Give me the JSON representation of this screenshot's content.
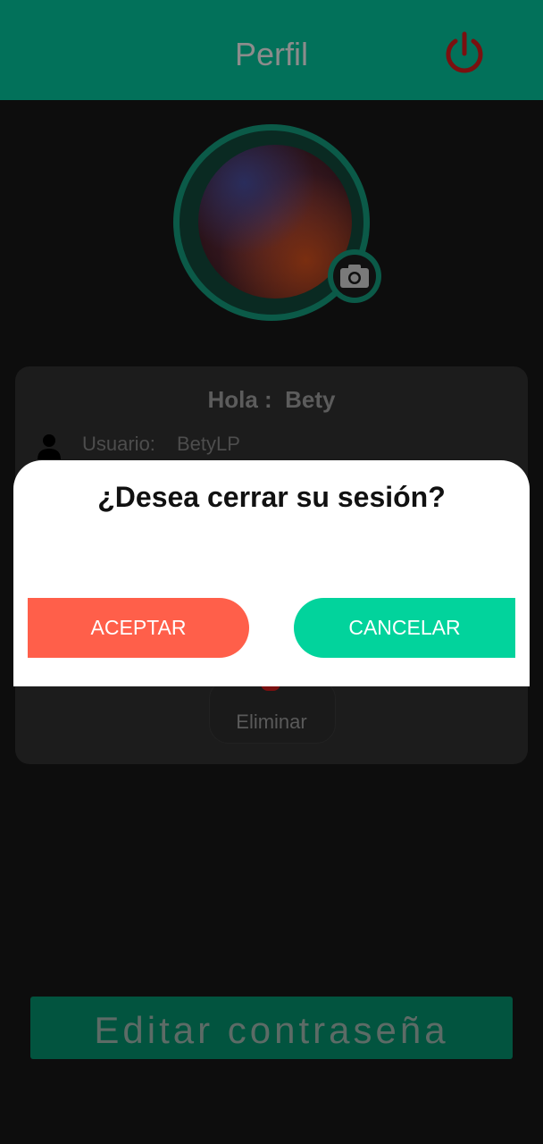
{
  "header": {
    "title": "Perfil",
    "logout_icon": "power-icon",
    "accent": "#02715a",
    "icon_color": "#7a1010"
  },
  "profile": {
    "avatar_icon": "camera-icon",
    "greeting_prefix": "Hola :",
    "greeting_name": "Bety",
    "user_label": "Usuario:",
    "user_value": "BetyLP",
    "delete_label": "Eliminar"
  },
  "footer": {
    "edit_password_label": "Editar contraseña"
  },
  "dialog": {
    "title": "¿Desea cerrar su sesión?",
    "accept_label": "ACEPTAR",
    "cancel_label": "CANCELAR",
    "accept_color": "#ff5f4a",
    "cancel_color": "#02d39c"
  }
}
